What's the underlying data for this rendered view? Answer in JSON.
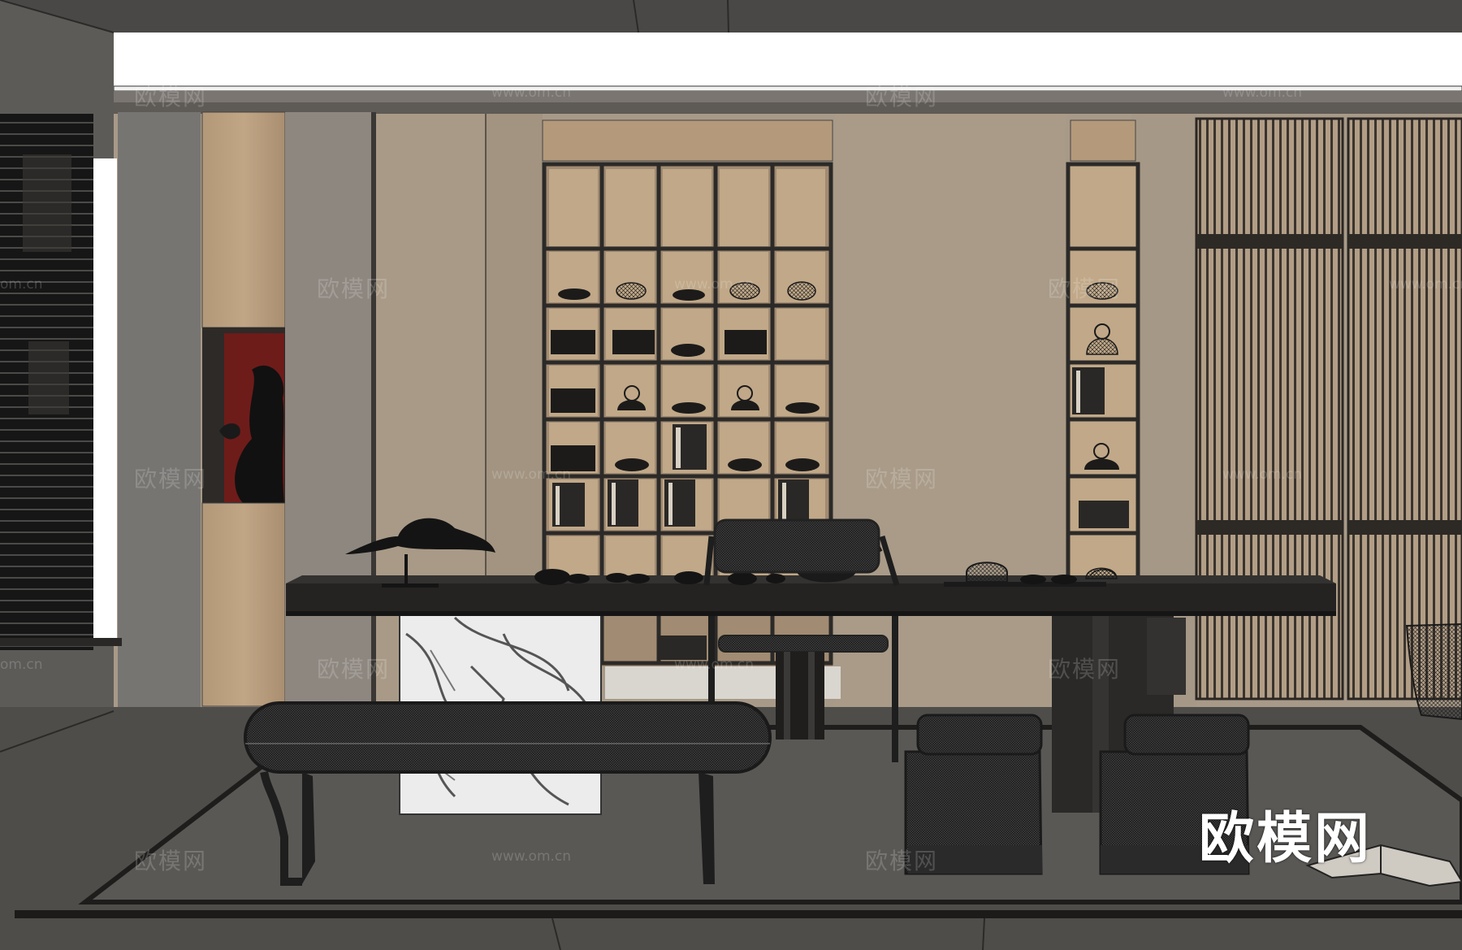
{
  "watermark": {
    "brand": "欧模网",
    "url": "www.om.cn",
    "url_partial": "om.cn"
  },
  "colors": {
    "ceiling_band": "#ffffff",
    "wall_beige": "#a89a88",
    "wood": "#b49a7a",
    "shelf_frame": "#2b2a28",
    "floor": "#4f4d4a",
    "rug": "#5a5855",
    "table": "#272626",
    "marble": "#e9e9e9",
    "accent_red": "#6e1c1a"
  }
}
